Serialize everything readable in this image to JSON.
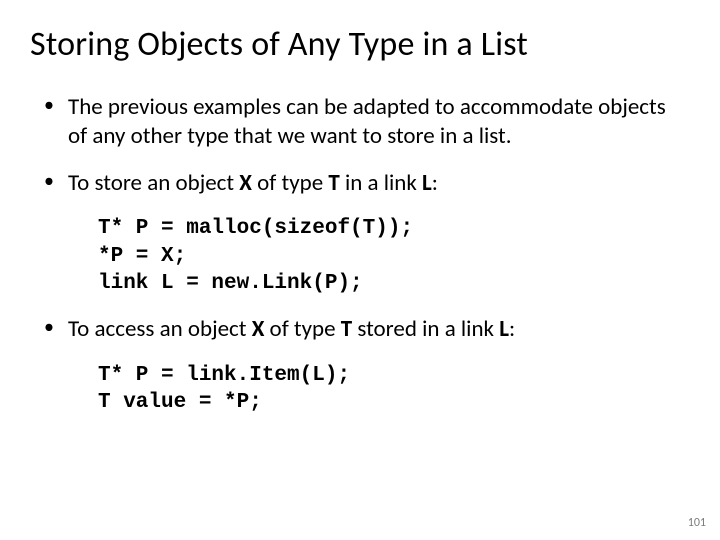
{
  "title": "Storing Objects of Any Type in a List",
  "bullet1": "The previous examples can be adapted to accommodate objects of any other type that we want to store in a list.",
  "bullet2": {
    "pre1": "To store an object ",
    "b1": "X",
    "mid1": " of type ",
    "b2": "T",
    "mid2": " in a link ",
    "b3": "L",
    "post": ":"
  },
  "code1": {
    "l1": "T* P = malloc(sizeof(T));",
    "l2": "*P = X;",
    "l3": "link L = new.Link(P);"
  },
  "bullet3": {
    "pre1": "To access an object ",
    "b1": "X",
    "mid1": " of type ",
    "b2": "T",
    "mid2": " stored in a link ",
    "b3": "L",
    "post": ":"
  },
  "code2": {
    "l1": "T* P = link.Item(L);",
    "l2": "T value = *P;"
  },
  "page": "101"
}
